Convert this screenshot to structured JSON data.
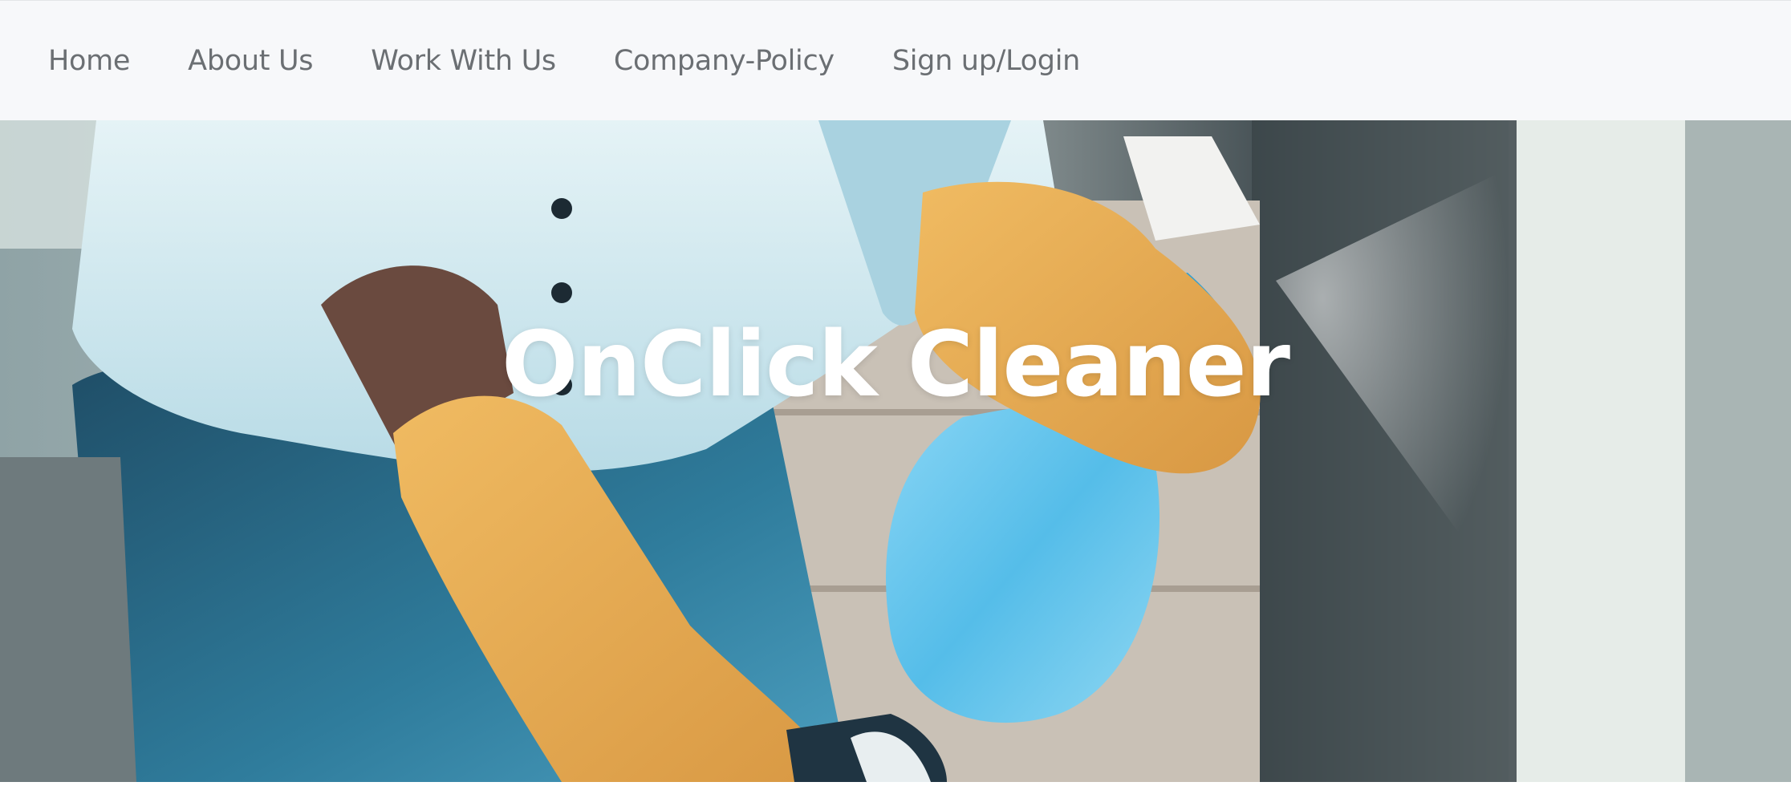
{
  "nav": {
    "items": [
      {
        "label": "Home"
      },
      {
        "label": "About Us"
      },
      {
        "label": "Work With Us"
      },
      {
        "label": "Company-Policy"
      },
      {
        "label": "Sign up/Login"
      }
    ]
  },
  "hero": {
    "title": "OnClick Cleaner",
    "image": "cleaning-photo-person-gloves-spray-bottle"
  },
  "colors": {
    "navbar_bg": "#f7f8fa",
    "nav_text": "#6b6f73",
    "hero_title": "#ffffff",
    "glove": "#e3a953",
    "spray_bottle": "#5cc0ec",
    "shirt": "#d6ecf2",
    "jeans": "#2f7c9c"
  }
}
